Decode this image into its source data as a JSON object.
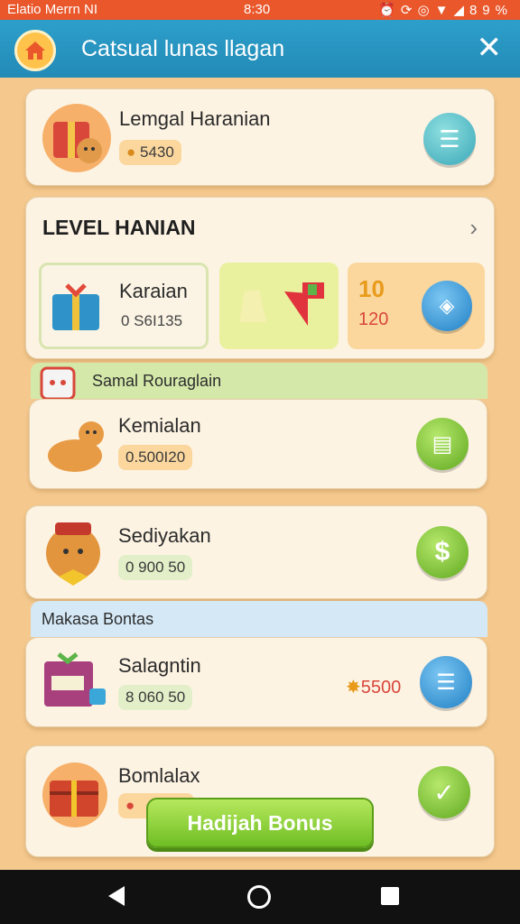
{
  "status_bar": {
    "carrier": "Elatio Merrn NI",
    "time": "8:30",
    "battery": "89%"
  },
  "app_bar": {
    "title": "Catsual lunas llagan"
  },
  "top_card": {
    "name": "Lemgal Haranian",
    "value": "5430"
  },
  "level_section": {
    "title": "LEVEL HANIAN",
    "tile1": {
      "name": "Karaian",
      "value": "0 S6I135"
    },
    "tile3": {
      "top": "10",
      "bottom": "120"
    }
  },
  "banner1": {
    "label": "Samal Rouraglain"
  },
  "items": [
    {
      "name": "Kemialan",
      "value": "0.500I20"
    },
    {
      "name": "Sediyakan",
      "value": "0 900 50"
    }
  ],
  "banner2": {
    "label": "Makasa Bontas"
  },
  "item3": {
    "name": "Salagntin",
    "value": "8 060 50",
    "reward": "5500"
  },
  "item4": {
    "name": "Bomlalax"
  },
  "bonus_button": {
    "label": "Hadijah Bonus"
  },
  "colors": {
    "status_bar": "#e9572b",
    "app_bar": "#2d9fcb",
    "background": "#f5c98e",
    "accent_green": "#6fbe24"
  }
}
